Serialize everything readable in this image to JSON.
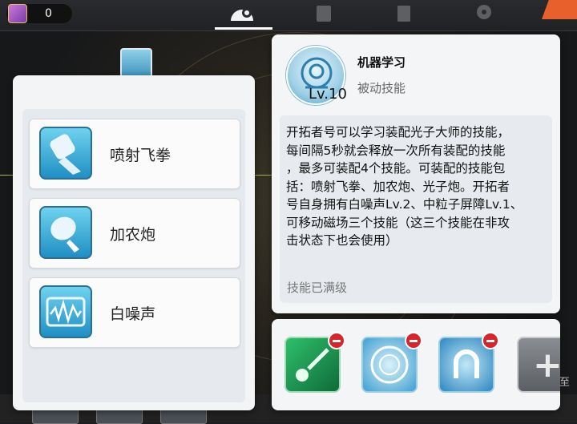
{
  "currency": {
    "value": "0"
  },
  "skills": [
    {
      "label": "喷射飞拳",
      "icon": "jet-fist-icon"
    },
    {
      "label": "加农炮",
      "icon": "cannon-icon"
    },
    {
      "label": "白噪声",
      "icon": "white-noise-icon"
    }
  ],
  "detail": {
    "level": "Lv.10",
    "name": "机器学习",
    "type": "被动技能",
    "description": [
      "开拓者号可以学习装配光子大师的技能，",
      "每间隔5秒就会释放一次所有装配的技能",
      "，最多可装配4个技能。可装配的技能包",
      "括：喷射飞拳、加农炮、光子炮。开拓者",
      "号自身拥有白噪声Lv.2、中粒子屏障Lv.1、",
      "可移动磁场三个技能（这三个技能在非攻",
      "击状态下也会使用）"
    ],
    "status": "技能已满级"
  },
  "equipped": [
    {
      "icon": "photon-cannon-icon"
    },
    {
      "icon": "particle-barrier-icon"
    },
    {
      "icon": "magnetic-field-icon"
    }
  ],
  "side_text": "至",
  "colors": {
    "accent": "#1f8fc4",
    "remove": "#d8242a",
    "badge": "#e8612c"
  }
}
